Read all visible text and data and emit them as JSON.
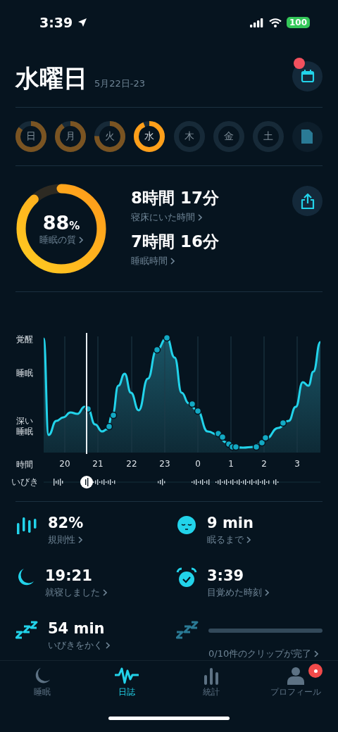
{
  "status_bar": {
    "time": "3:39",
    "battery": "100"
  },
  "header": {
    "title": "水曜日",
    "date_range": "5月22日-23",
    "calendar_badge": true
  },
  "days": [
    {
      "label": "日",
      "level": 0.85,
      "selected": false
    },
    {
      "label": "月",
      "level": 0.9,
      "selected": false
    },
    {
      "label": "火",
      "level": 0.75,
      "selected": false
    },
    {
      "label": "水",
      "level": 0.93,
      "selected": true
    },
    {
      "label": "木",
      "level": 0,
      "selected": false
    },
    {
      "label": "金",
      "level": 0,
      "selected": false
    },
    {
      "label": "土",
      "level": 0,
      "selected": false
    }
  ],
  "summary": {
    "quality": {
      "value": "88",
      "unit": "%",
      "label": "睡眠の質",
      "level": 0.88
    },
    "metrics": [
      {
        "value": "8時間 17分",
        "label": "寝床にいた時間"
      },
      {
        "value": "7時間 16分",
        "label": "睡眠時間"
      }
    ]
  },
  "sleep_chart": {
    "y_labels": [
      "覚醒",
      "睡眠",
      "深い睡眠"
    ],
    "x_title": "時間",
    "x_labels": [
      "20",
      "21",
      "22",
      "23",
      "0",
      "1",
      "2",
      "3"
    ],
    "snore_title": "いびき"
  },
  "stats": [
    {
      "kind": "regularity",
      "value": "82%",
      "label": "規則性"
    },
    {
      "kind": "asleep",
      "value": "9 min",
      "label": "眠るまで"
    },
    {
      "kind": "bedtime",
      "value": "19:21",
      "label": "就寝しました"
    },
    {
      "kind": "wakeup",
      "value": "3:39",
      "label": "目覚めた時刻"
    },
    {
      "kind": "snoring",
      "value": "54 min",
      "label": "いびきをかく"
    },
    {
      "kind": "clips",
      "level": 0,
      "label": "0/10件のクリップが完了"
    }
  ],
  "tab_bar": [
    {
      "kind": "sleep",
      "label": "睡眠",
      "selected": false,
      "badge": false
    },
    {
      "kind": "journal",
      "label": "日誌",
      "selected": true,
      "badge": false
    },
    {
      "kind": "stats",
      "label": "統計",
      "selected": false,
      "badge": false
    },
    {
      "kind": "profile",
      "label": "プロフィール",
      "selected": false,
      "badge": true
    }
  ]
}
